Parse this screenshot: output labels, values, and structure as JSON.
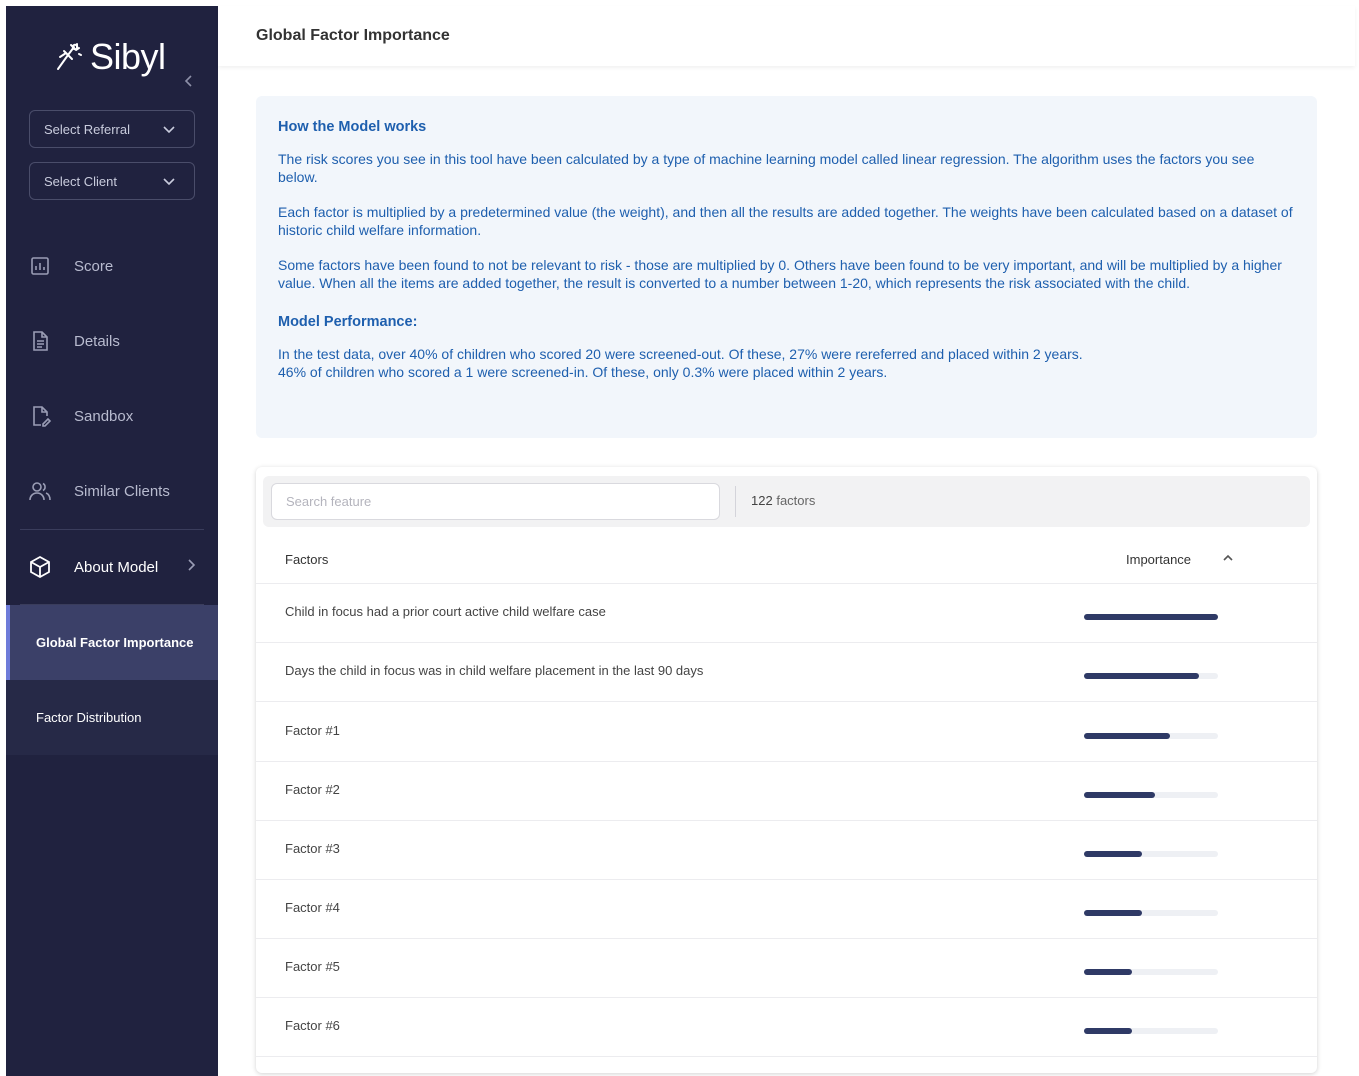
{
  "brand": {
    "name": "Sibyl"
  },
  "sidebar": {
    "select_referral": "Select Referral",
    "select_client": "Select Client",
    "nav": [
      {
        "label": "Score",
        "icon": "bar-chart-icon"
      },
      {
        "label": "Details",
        "icon": "document-icon"
      },
      {
        "label": "Sandbox",
        "icon": "edit-document-icon"
      },
      {
        "label": "Similar Clients",
        "icon": "users-icon"
      },
      {
        "label": "About Model",
        "icon": "cube-icon"
      }
    ],
    "sub_items": [
      {
        "label": "Global Factor Importance",
        "active": true
      },
      {
        "label": "Factor Distribution",
        "active": false
      }
    ]
  },
  "header": {
    "title": "Global Factor Importance"
  },
  "info": {
    "title": "How the Model works",
    "paragraphs": [
      "The risk scores you see in this tool have been calculated by a type of machine learning model called linear regression. The algorithm uses the factors you see below.",
      "Each factor is multiplied by a predetermined value (the weight), and then all the results are added together. The weights have been calculated based on a dataset of historic child welfare information.",
      "Some factors have been found to not be relevant to risk - those are multiplied by 0. Others have been found to be very important, and will be multiplied by a higher value. When all the items are added together, the result is converted to a number between 1-20, which represents the risk associated with the child."
    ],
    "performance_title": "Model Performance:",
    "performance_lines": [
      "In the test data, over 40% of children who scored 20 were screened-out. Of these, 27% were rereferred and placed within 2 years.",
      "46% of children who scored a 1 were screened-in. Of these, only 0.3% were placed within 2 years."
    ]
  },
  "table": {
    "search_placeholder": "Search feature",
    "count_number": "122",
    "count_label": "factors",
    "col_factors": "Factors",
    "col_importance": "Importance",
    "rows": [
      {
        "label": "Child in focus had a prior court active child welfare case",
        "importance": 1.0
      },
      {
        "label": "Days the child in focus was in child welfare placement in the last 90 days",
        "importance": 0.86
      },
      {
        "label": "Factor #1",
        "importance": 0.64
      },
      {
        "label": "Factor #2",
        "importance": 0.53
      },
      {
        "label": "Factor #3",
        "importance": 0.43
      },
      {
        "label": "Factor #4",
        "importance": 0.43
      },
      {
        "label": "Factor #5",
        "importance": 0.36
      },
      {
        "label": "Factor #6",
        "importance": 0.36
      }
    ]
  },
  "colors": {
    "sidebar_bg": "#20223f",
    "accent": "#6e7bd9",
    "info_text": "#1e5fae",
    "bar": "#2f3a66"
  }
}
